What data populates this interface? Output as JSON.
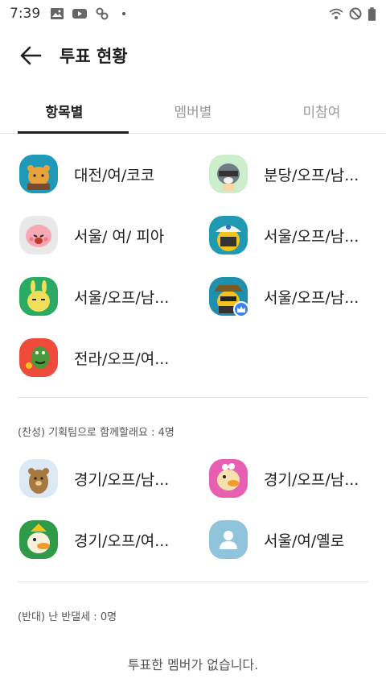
{
  "status_bar": {
    "time": "7:39",
    "left_icons": [
      "image-icon",
      "youtube-icon",
      "app-icon"
    ],
    "right_icons": [
      "wifi-icon",
      "dnd-icon",
      "battery-icon"
    ]
  },
  "header": {
    "title": "투표 현황",
    "back_icon": "back-arrow-icon"
  },
  "tabs": [
    {
      "label": "항목별",
      "active": true
    },
    {
      "label": "멤버별",
      "active": false
    },
    {
      "label": "미참여",
      "active": false
    }
  ],
  "top_members": [
    {
      "name": "대전/여/코코",
      "avatar_color": "#1e9ab8"
    },
    {
      "name": "분당/오프/남...",
      "avatar_color": "#cdeecd"
    },
    {
      "name": "서울/ 여/ 피아",
      "avatar_color": "#e8e8e8"
    },
    {
      "name": "서울/오프/남...",
      "avatar_color": "#1f9ab2"
    },
    {
      "name": "서울/오프/남...",
      "avatar_color": "#2aaa63"
    },
    {
      "name": "서울/오프/남...",
      "avatar_color": "#1f8fb0",
      "host": true
    },
    {
      "name": "전라/오프/여...",
      "avatar_color": "#ee4b3a"
    }
  ],
  "sections": [
    {
      "label": "(찬성) 기획팀으로 함께할래요 : 4명",
      "members": [
        {
          "name": "경기/오프/남...",
          "avatar_color": "#dce8f4"
        },
        {
          "name": "경기/오프/남...",
          "avatar_color": "#e85fb2"
        },
        {
          "name": "경기/오프/여...",
          "avatar_color": "#2f9a4a"
        },
        {
          "name": "서울/여/옐로",
          "avatar_color": "#8fc4da"
        }
      ]
    },
    {
      "label": "(반대) 난 반댈세 : 0명",
      "empty_text": "투표한 멤버가 없습니다."
    }
  ]
}
